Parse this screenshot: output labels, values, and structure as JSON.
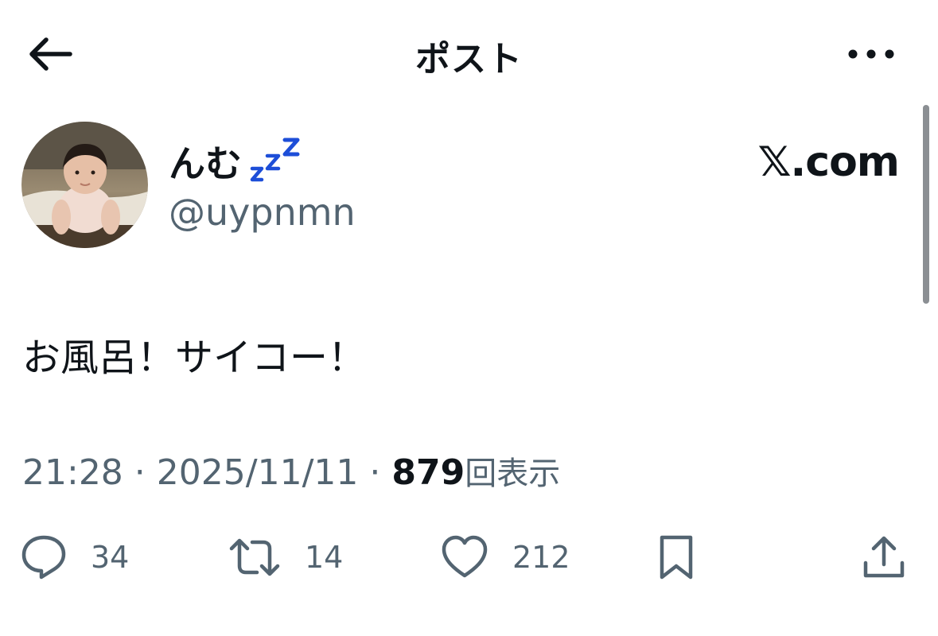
{
  "header": {
    "title": "ポスト",
    "back_icon": "arrow-left-icon",
    "more_icon": "more-horizontal-icon"
  },
  "author": {
    "display_name": "んむ",
    "status_emoji": "zzz-icon",
    "handle": "@uypnmn",
    "avatar": "avatar-photo-baby"
  },
  "watermark": "𝕏.com",
  "post": {
    "text": "お風呂！サイコー！"
  },
  "meta": {
    "time": "21:28",
    "separator1": " · ",
    "date": "2025/11/11",
    "separator2": " · ",
    "views_count": "879",
    "views_label": "回表示"
  },
  "actions": {
    "reply": {
      "icon": "reply-bubble-icon",
      "count": "34"
    },
    "repost": {
      "icon": "repost-icon",
      "count": "14"
    },
    "like": {
      "icon": "heart-icon",
      "count": "212"
    },
    "bookmark": {
      "icon": "bookmark-icon"
    },
    "share": {
      "icon": "share-icon"
    }
  },
  "colors": {
    "text": "#0f1419",
    "secondary": "#536471",
    "zzz_blue": "#1d4ed8",
    "background": "#ffffff"
  }
}
